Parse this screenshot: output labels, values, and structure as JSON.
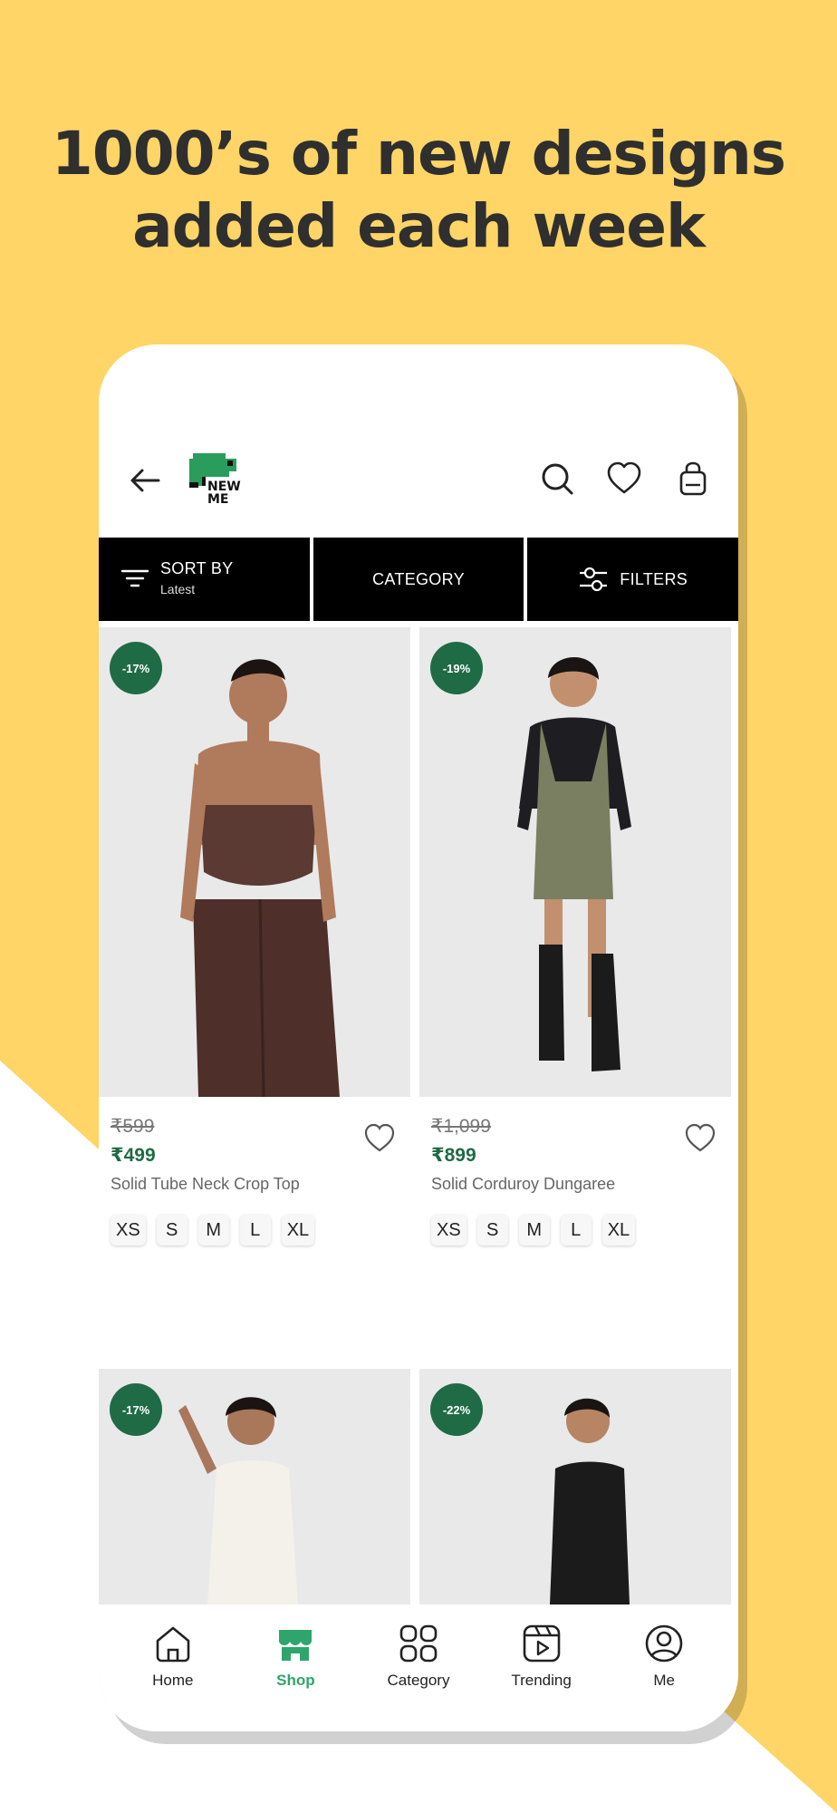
{
  "headline": {
    "line1": "1000’s of new designs",
    "line2": "added each week"
  },
  "brand": {
    "logo_text": "NEW\nME",
    "accent": "#1f6b45"
  },
  "filter_bar": {
    "sort_label": "SORT BY",
    "sort_value": "Latest",
    "category_label": "CATEGORY",
    "filters_label": "FILTERS"
  },
  "products": [
    {
      "badge": "-17%",
      "mrp": "₹599",
      "price": "₹499",
      "name": "Solid Tube Neck Crop Top",
      "sizes": [
        "XS",
        "S",
        "M",
        "L",
        "XL"
      ]
    },
    {
      "badge": "-19%",
      "mrp": "₹1,099",
      "price": "₹899",
      "name": "Solid Corduroy Dungaree",
      "sizes": [
        "XS",
        "S",
        "M",
        "L",
        "XL"
      ]
    },
    {
      "badge": "-17%"
    },
    {
      "badge": "-22%"
    }
  ],
  "bottom_nav": [
    {
      "label": "Home",
      "icon": "home-icon",
      "active": false
    },
    {
      "label": "Shop",
      "icon": "shop-icon",
      "active": true
    },
    {
      "label": "Category",
      "icon": "category-icon",
      "active": false
    },
    {
      "label": "Trending",
      "icon": "trending-icon",
      "active": false
    },
    {
      "label": "Me",
      "icon": "profile-icon",
      "active": false
    }
  ],
  "colors": {
    "background": "#fed566",
    "price_green": "#1f6b45",
    "active_nav": "#2fa56b"
  }
}
